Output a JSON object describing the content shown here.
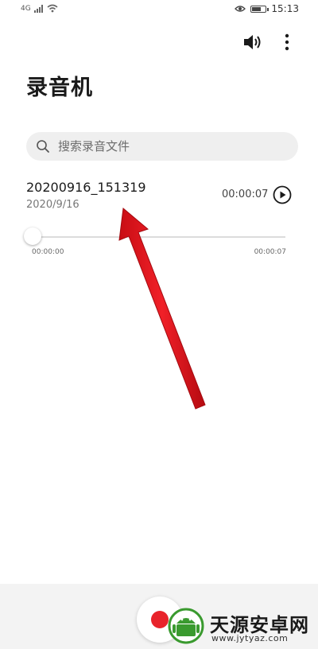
{
  "status_bar": {
    "signal_text": "4G",
    "time": "15:13"
  },
  "header": {
    "title": "录音机",
    "speaker_icon": "speaker-icon",
    "more_icon": "more-vertical-icon"
  },
  "search": {
    "placeholder": "搜索录音文件",
    "value": ""
  },
  "recordings": [
    {
      "name": "20200916_151319",
      "date": "2020/9/16",
      "duration": "00:00:07",
      "position_start": "00:00:00",
      "position_end": "00:00:07",
      "progress": 0.0
    }
  ],
  "watermark": {
    "text": "天源安卓网",
    "url": "www.jytyaz.com"
  },
  "colors": {
    "record_red": "#e8232b",
    "annotation_red": "#e3141d",
    "watermark_green": "#3a9a2f"
  }
}
